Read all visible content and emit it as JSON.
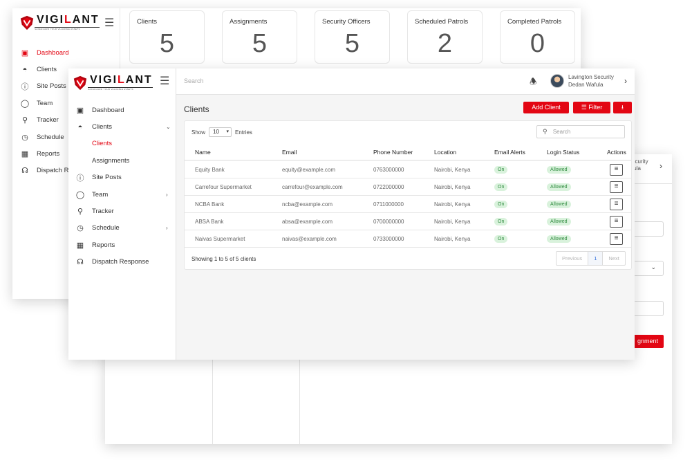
{
  "logo": {
    "text_prefix": "VIGI",
    "text_accent": "L",
    "text_suffix": "ANT",
    "tagline": "SAFEGUARD YOUR VALUABLE ASSETS"
  },
  "dashboard": {
    "nav": [
      {
        "label": "Dashboard",
        "icon": "grid-icon",
        "active": true
      },
      {
        "label": "Clients",
        "icon": "contact-icon",
        "chevron": true
      },
      {
        "label": "Site Posts",
        "icon": "alert-circle-icon"
      },
      {
        "label": "Team",
        "icon": "shield-outline-icon"
      },
      {
        "label": "Tracker",
        "icon": "route-icon"
      },
      {
        "label": "Schedule",
        "icon": "clock-icon"
      },
      {
        "label": "Reports",
        "icon": "reports-icon"
      },
      {
        "label": "Dispatch R",
        "icon": "headset-icon"
      }
    ],
    "cards": [
      {
        "label": "Clients",
        "value": "5"
      },
      {
        "label": "Assignments",
        "value": "5"
      },
      {
        "label": "Security Officers",
        "value": "5"
      },
      {
        "label": "Scheduled Patrols",
        "value": "2"
      },
      {
        "label": "Completed Patrols",
        "value": "0"
      }
    ]
  },
  "assignment_window": {
    "profile_line1": "ecurity",
    "profile_line2": "fula",
    "button_label": "gnment"
  },
  "clients_page": {
    "search_placeholder": "Search",
    "user": {
      "company": "Lavington Security",
      "name": "Dedan Wafula"
    },
    "nav": [
      {
        "label": "Dashboard",
        "icon": "grid-icon"
      },
      {
        "label": "Clients",
        "icon": "contact-icon",
        "chevron": "down"
      },
      {
        "label": "Clients",
        "sub": true,
        "active": true
      },
      {
        "label": "Assignments",
        "sub": true
      },
      {
        "label": "Site Posts",
        "icon": "alert-circle-icon"
      },
      {
        "label": "Team",
        "icon": "shield-outline-icon",
        "chevron": "right"
      },
      {
        "label": "Tracker",
        "icon": "route-icon"
      },
      {
        "label": "Schedule",
        "icon": "clock-icon",
        "chevron": "right"
      },
      {
        "label": "Reports",
        "icon": "reports-icon"
      },
      {
        "label": "Dispatch Response",
        "icon": "headset-icon"
      }
    ],
    "title": "Clients",
    "add_client_label": "Add Client",
    "filter_label": "Filter",
    "show_label": "Show",
    "entries_value": "10",
    "entries_label": "Entries",
    "table_search_placeholder": "Search",
    "columns": [
      "Name",
      "Email",
      "Phone Number",
      "Location",
      "Email Alerts",
      "Login Status",
      "Actions"
    ],
    "rows": [
      {
        "name": "Equity Bank",
        "email": "equity@example.com",
        "phone": "0763000000",
        "location": "Nairobi, Kenya",
        "alerts": "On",
        "status": "Allowed"
      },
      {
        "name": "Carrefour Supermarket",
        "email": "carrefour@example.com",
        "phone": "0722000000",
        "location": "Nairobi, Kenya",
        "alerts": "On",
        "status": "Allowed"
      },
      {
        "name": "NCBA Bank",
        "email": "ncba@example.com",
        "phone": "0711000000",
        "location": "Nairobi, Kenya",
        "alerts": "On",
        "status": "Allowed"
      },
      {
        "name": "ABSA Bank",
        "email": "absa@example.com",
        "phone": "0700000000",
        "location": "Nairobi, Kenya",
        "alerts": "On",
        "status": "Allowed"
      },
      {
        "name": "Naivas Supermarket",
        "email": "naivas@example.com",
        "phone": "0733000000",
        "location": "Nairobi, Kenya",
        "alerts": "On",
        "status": "Allowed"
      }
    ],
    "showing_text": "Showing 1 to 5 of 5 clients",
    "pager": {
      "prev": "Previous",
      "current": "1",
      "next": "Next"
    }
  },
  "colors": {
    "accent": "#e30613",
    "badge_bg": "#d9f2dc",
    "badge_text": "#2e8b3e",
    "pager_current": "#2f6ddc"
  }
}
